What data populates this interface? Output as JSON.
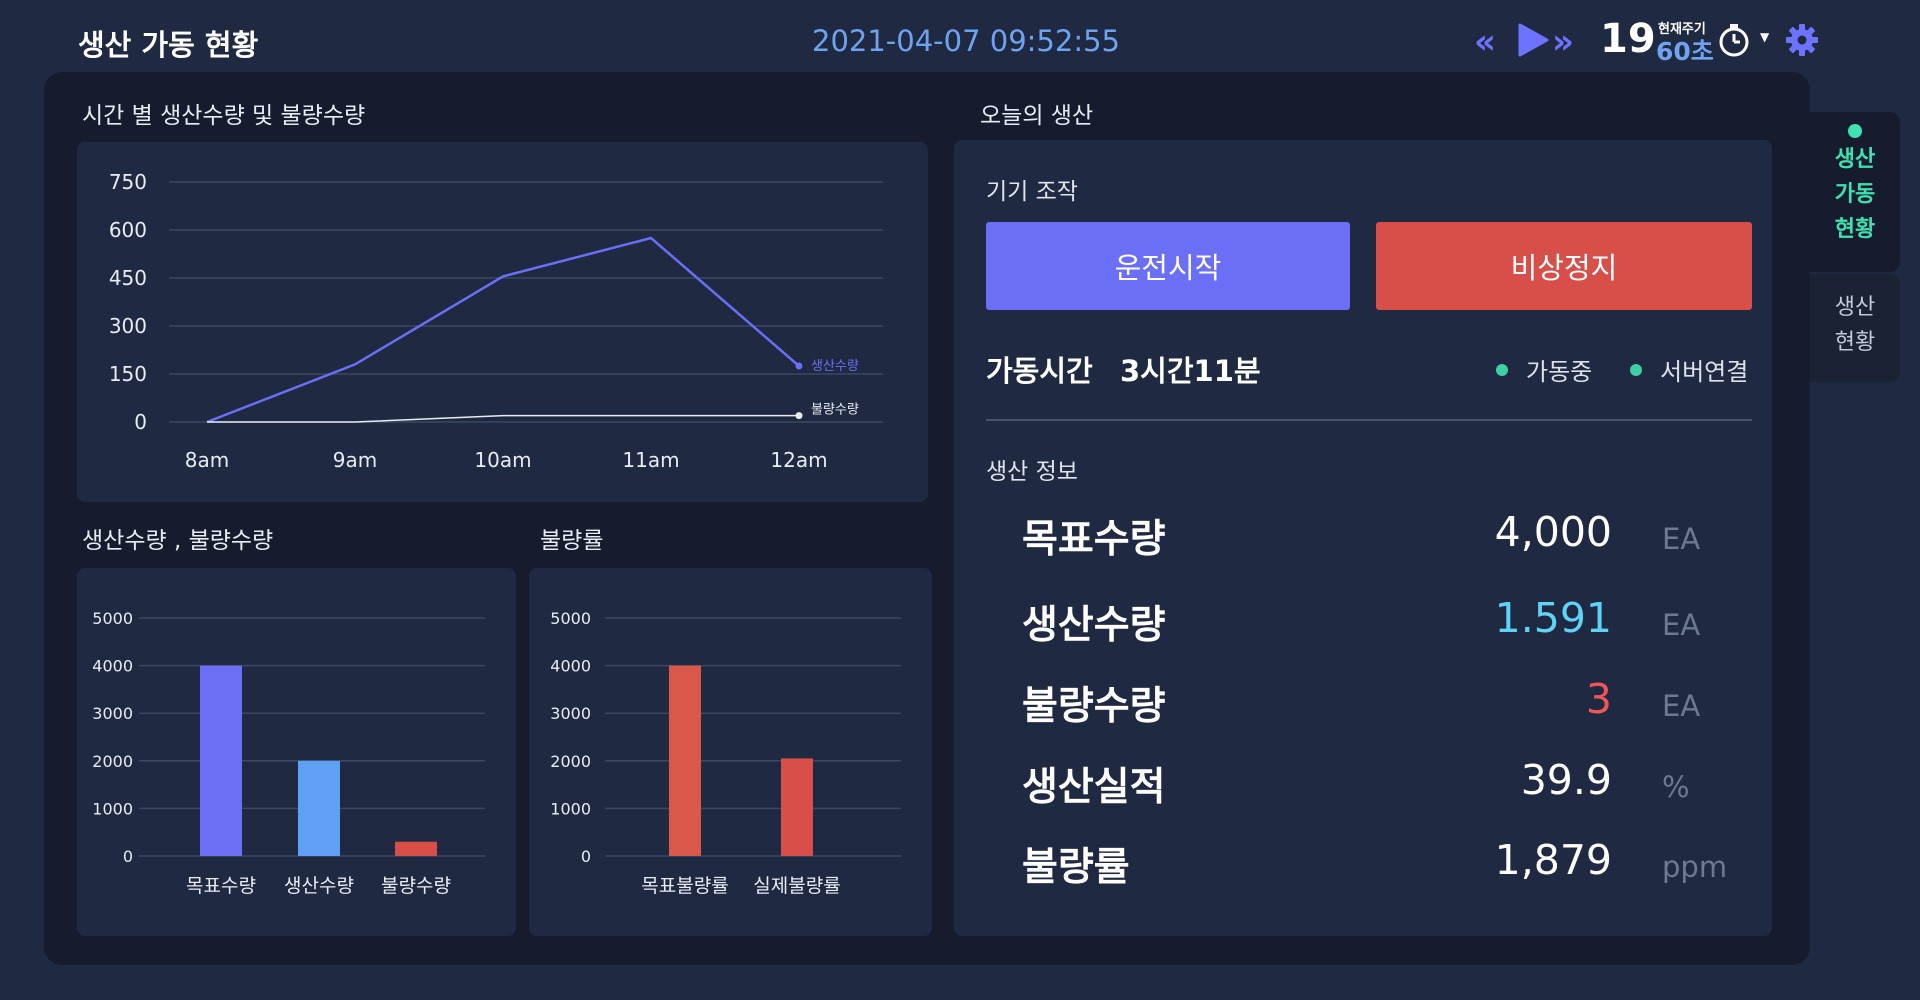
{
  "header": {
    "title": "생산 가동 현황",
    "datetime": "2021-04-07 09:52:55",
    "counter": "19",
    "cycle_label": "현재주기",
    "cycle_value": "60초",
    "icons": [
      "rewind-icon",
      "play-icon",
      "fast-forward-icon",
      "timer-icon",
      "chevron-down-icon",
      "gear-icon"
    ]
  },
  "nav": {
    "items": [
      {
        "label": "생산 가동 현황",
        "active": true
      },
      {
        "label": "생산 현황",
        "active": false
      }
    ]
  },
  "sections": {
    "hourly": "시간 별 생산수량 및 불량수량",
    "quantities": "생산수량 , 불량수량",
    "defect_rate": "불량률",
    "today": "오늘의 생산"
  },
  "today": {
    "control_title": "기기 조작",
    "start_label": "운전시작",
    "stop_label": "비상정지",
    "optime_label": "가동시간",
    "optime_value": "3시간11분",
    "status_running": "가동중",
    "status_server": "서버연결",
    "info_title": "생산 정보",
    "rows": [
      {
        "label": "목표수량",
        "value": "4,000",
        "unit": "EA",
        "color": "#ffffff"
      },
      {
        "label": "생산수량",
        "value": "1.591",
        "unit": "EA",
        "color": "#5fd3f5"
      },
      {
        "label": "불량수량",
        "value": "3",
        "unit": "EA",
        "color": "#f0555a"
      },
      {
        "label": "생산실적",
        "value": "39.9",
        "unit": "%",
        "color": "#ffffff"
      },
      {
        "label": "불량률",
        "value": "1,879",
        "unit": "ppm",
        "color": "#ffffff"
      }
    ]
  },
  "colors": {
    "accent": "#6a6ff5",
    "danger": "#d84f4a",
    "status_ok": "#3ecfa5",
    "nav_active": "#3ee2b0"
  },
  "chart_data": [
    {
      "type": "line",
      "title": "시간 별 생산수량 및 불량수량",
      "x": [
        "8am",
        "9am",
        "10am",
        "11am",
        "12am"
      ],
      "series": [
        {
          "name": "생산수량",
          "values": [
            0,
            180,
            455,
            575,
            175
          ],
          "color": "#6a6ff5"
        },
        {
          "name": "불량수량",
          "values": [
            0,
            0,
            20,
            20,
            20
          ],
          "color": "#e8ecf4"
        }
      ],
      "ylim": [
        0,
        750
      ],
      "yticks": [
        0,
        150,
        300,
        450,
        600,
        750
      ],
      "grid": true
    },
    {
      "type": "bar",
      "title": "생산수량 , 불량수량",
      "categories": [
        "목표수량",
        "생산수량",
        "불량수량"
      ],
      "values": [
        4000,
        2000,
        300
      ],
      "colors": [
        "#6a6ff5",
        "#5fa0f5",
        "#d84f4a"
      ],
      "ylim": [
        0,
        5000
      ],
      "yticks": [
        0,
        1000,
        2000,
        3000,
        4000,
        5000
      ],
      "grid": true
    },
    {
      "type": "bar",
      "title": "불량률",
      "categories": [
        "목표불량률",
        "실제불량률"
      ],
      "values": [
        4000,
        2050
      ],
      "colors": [
        "#d9584a",
        "#d84f4a"
      ],
      "ylim": [
        0,
        5000
      ],
      "yticks": [
        0,
        1000,
        2000,
        3000,
        4000,
        5000
      ],
      "grid": true
    }
  ]
}
